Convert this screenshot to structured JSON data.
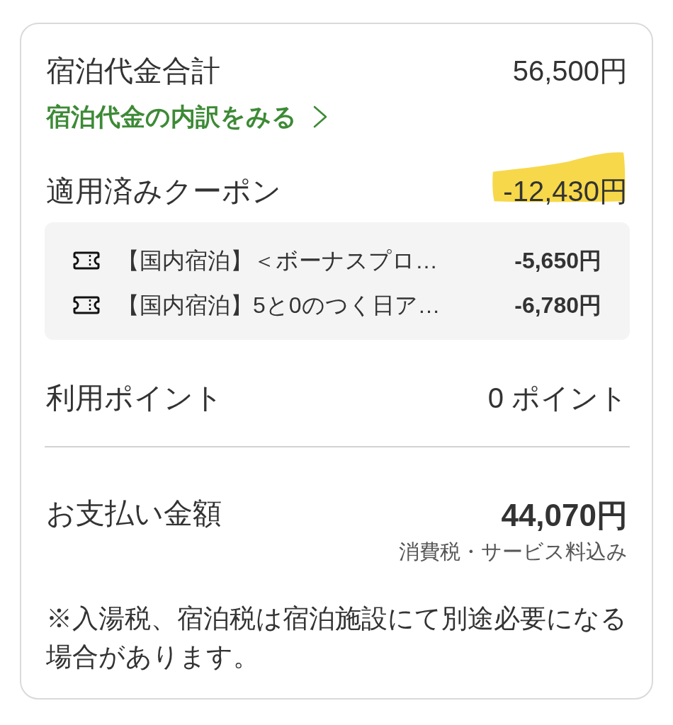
{
  "summary": {
    "label": "宿泊代金合計",
    "amount": "56,500円"
  },
  "breakdown_link": {
    "label": "宿泊代金の内訳をみる"
  },
  "coupons": {
    "label": "適用済みクーポン",
    "amount": "-12,430円",
    "highlighted": true,
    "items": [
      {
        "name": "【国内宿泊】＜ボーナスプロ…",
        "amount": "-5,650円"
      },
      {
        "name": "【国内宿泊】5と0のつく日ア…",
        "amount": "-6,780円"
      }
    ]
  },
  "points": {
    "label": "利用ポイント",
    "value": "0 ポイント"
  },
  "payment": {
    "label": "お支払い金額",
    "amount": "44,070円",
    "tax_note": "消費税・サービス料込み"
  },
  "disclaimer": "※入湯税、宿泊税は宿泊施設にて別途必要になる場合があります。"
}
